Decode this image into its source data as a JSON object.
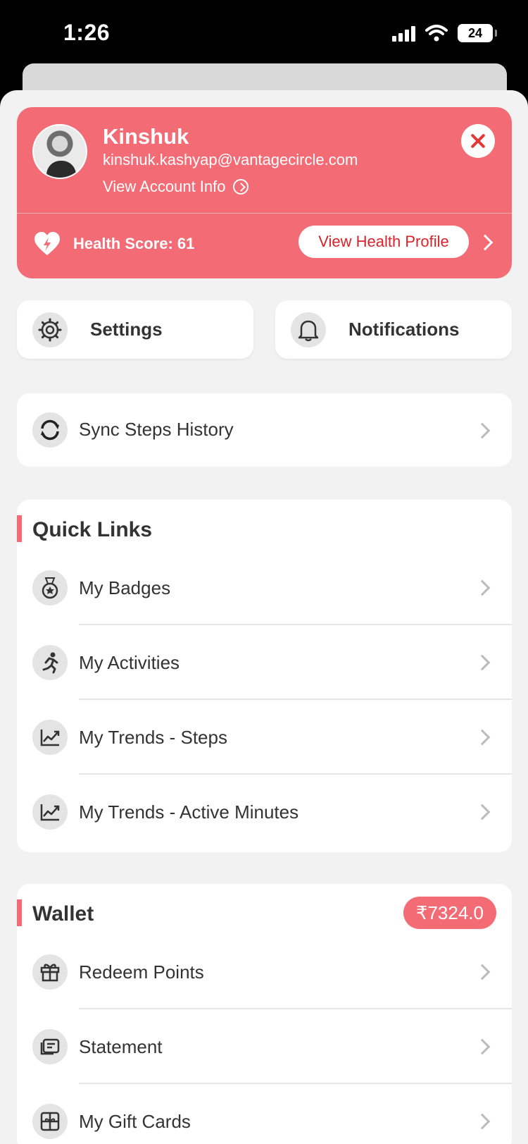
{
  "status": {
    "time": "1:26",
    "battery": "24"
  },
  "profile": {
    "name": "Kinshuk",
    "email": "kinshuk.kashyap@vantagecircle.com",
    "account_link": "View Account Info",
    "health_score": "Health Score: 61",
    "health_button": "View Health Profile"
  },
  "tiles": {
    "settings": "Settings",
    "notifications": "Notifications"
  },
  "sync": {
    "label": "Sync Steps History"
  },
  "quick_links": {
    "title": "Quick Links",
    "items": [
      {
        "label": "My Badges",
        "icon": "badge-icon"
      },
      {
        "label": "My Activities",
        "icon": "running-icon"
      },
      {
        "label": "My Trends - Steps",
        "icon": "trend-icon"
      },
      {
        "label": "My Trends - Active Minutes",
        "icon": "trend-icon"
      }
    ]
  },
  "wallet": {
    "title": "Wallet",
    "balance": "₹7324.0",
    "items": [
      {
        "label": "Redeem Points",
        "icon": "gift-icon"
      },
      {
        "label": "Statement",
        "icon": "statement-icon"
      },
      {
        "label": "My Gift Cards",
        "icon": "gift-card-icon"
      }
    ]
  },
  "colors": {
    "accent": "#f36b74",
    "danger": "#d8232a",
    "background": "#f2f2f2"
  }
}
